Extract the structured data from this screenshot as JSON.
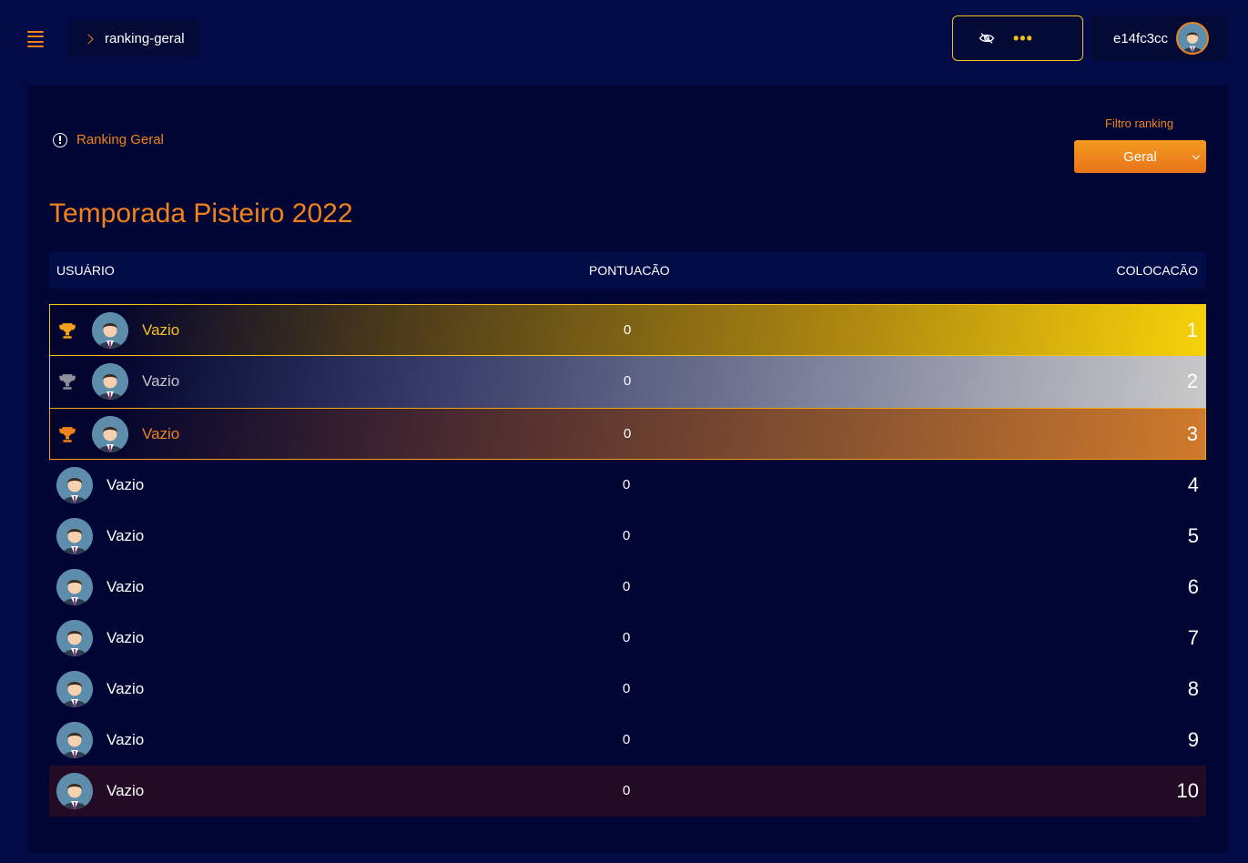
{
  "header": {
    "breadcrumb": "ranking-geral",
    "balance_dots": "•••",
    "username": "e14fc3cc"
  },
  "panel": {
    "section_label": "Ranking Geral",
    "filter_label": "Filtro ranking",
    "filter_value": "Geral",
    "title": "Temporada Pisteiro 2022"
  },
  "table": {
    "headers": {
      "user": "USUÁRIO",
      "points": "PONTUACÃO",
      "place": "COLOCACÃO"
    },
    "rows": [
      {
        "name": "Vazio",
        "points": "0",
        "place": "1"
      },
      {
        "name": "Vazio",
        "points": "0",
        "place": "2"
      },
      {
        "name": "Vazio",
        "points": "0",
        "place": "3"
      },
      {
        "name": "Vazio",
        "points": "0",
        "place": "4"
      },
      {
        "name": "Vazio",
        "points": "0",
        "place": "5"
      },
      {
        "name": "Vazio",
        "points": "0",
        "place": "6"
      },
      {
        "name": "Vazio",
        "points": "0",
        "place": "7"
      },
      {
        "name": "Vazio",
        "points": "0",
        "place": "8"
      },
      {
        "name": "Vazio",
        "points": "0",
        "place": "9"
      },
      {
        "name": "Vazio",
        "points": "0",
        "place": "10"
      }
    ]
  },
  "icons": {
    "menu": "hamburger-icon",
    "breadcrumb": "chevron-right-icon",
    "balance": "eye-slash-icon",
    "info": "info-circle-icon",
    "trophy": "trophy-icon",
    "avatar": "user-avatar-icon"
  },
  "colors": {
    "background": "#020b45",
    "panel": "#000533",
    "accent": "#f0821e",
    "gold": "#f5c21b",
    "silver": "#c0c0c0",
    "bronze": "#d07a2c"
  }
}
